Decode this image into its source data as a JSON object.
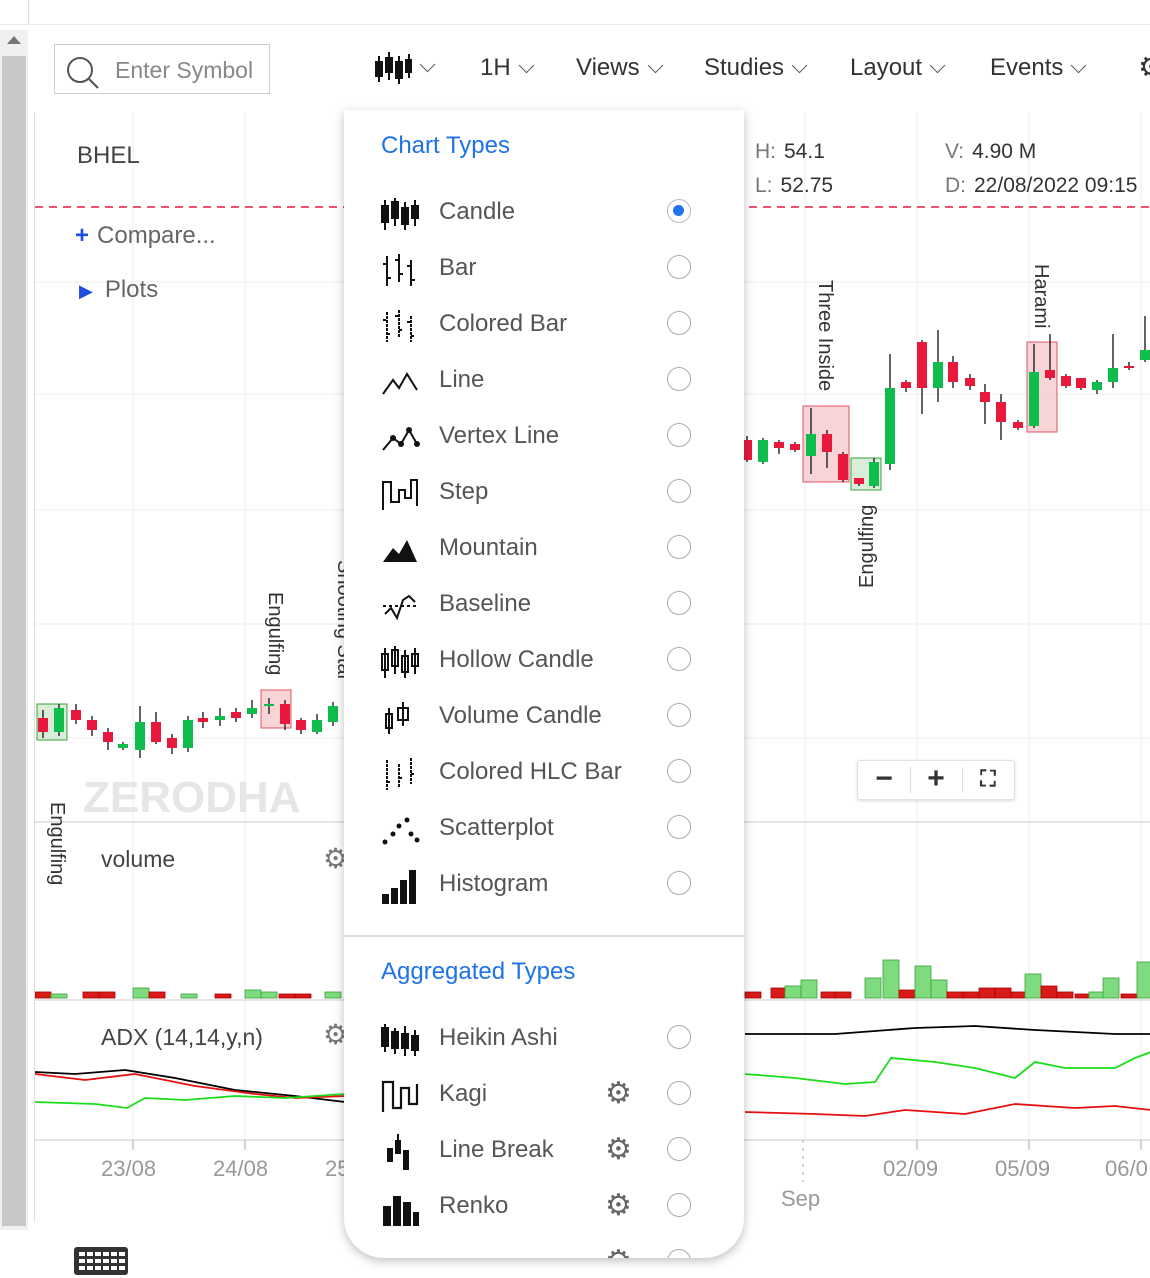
{
  "toolbar": {
    "search_placeholder": "Enter Symbol",
    "interval": "1H",
    "views": "Views",
    "studies": "Studies",
    "layout": "Layout",
    "events": "Events"
  },
  "chart": {
    "symbol": "BHEL",
    "compare": "Compare...",
    "plots": "Plots",
    "ohlc": {
      "h_label": "H:",
      "h": "54.1",
      "l_label": "L:",
      "l": "52.75",
      "v_label": "V:",
      "v": "4.90 M",
      "d_label": "D:",
      "d": "22/08/2022 09:15"
    },
    "panels": {
      "volume": "volume",
      "adx": "ADX (14,14,y,n)"
    },
    "watermark": "ZERODHA",
    "patterns": [
      "Engulfing",
      "Engulfing",
      "Shooting Star",
      "Three Inside",
      "Engulfing",
      "Harami"
    ],
    "time_labels": [
      "23/08",
      "24/08",
      "25",
      "Sep",
      "02/09",
      "05/09",
      "06/0"
    ],
    "colors": {
      "up": "#0ebd4b",
      "down": "#e8193c",
      "adx": "#000000",
      "di_plus": "#1bdd1b",
      "di_minus": "#e61010",
      "accent": "#1e73e8"
    }
  },
  "menu": {
    "chart_types_title": "Chart Types",
    "aggregated_title": "Aggregated Types",
    "chart_types": [
      {
        "name": "Candle",
        "icon": "candle-icon",
        "selected": true
      },
      {
        "name": "Bar",
        "icon": "bar-icon",
        "selected": false
      },
      {
        "name": "Colored Bar",
        "icon": "colored-bar-icon",
        "selected": false
      },
      {
        "name": "Line",
        "icon": "line-icon",
        "selected": false
      },
      {
        "name": "Vertex Line",
        "icon": "vertex-line-icon",
        "selected": false
      },
      {
        "name": "Step",
        "icon": "step-icon",
        "selected": false
      },
      {
        "name": "Mountain",
        "icon": "mountain-icon",
        "selected": false
      },
      {
        "name": "Baseline",
        "icon": "baseline-icon",
        "selected": false
      },
      {
        "name": "Hollow Candle",
        "icon": "hollow-candle-icon",
        "selected": false
      },
      {
        "name": "Volume Candle",
        "icon": "volume-candle-icon",
        "selected": false
      },
      {
        "name": "Colored HLC Bar",
        "icon": "colored-hlc-bar-icon",
        "selected": false
      },
      {
        "name": "Scatterplot",
        "icon": "scatterplot-icon",
        "selected": false
      },
      {
        "name": "Histogram",
        "icon": "histogram-icon",
        "selected": false
      }
    ],
    "aggregated_types": [
      {
        "name": "Heikin Ashi",
        "icon": "heikin-ashi-icon",
        "gear": false
      },
      {
        "name": "Kagi",
        "icon": "kagi-icon",
        "gear": true
      },
      {
        "name": "Line Break",
        "icon": "line-break-icon",
        "gear": true
      },
      {
        "name": "Renko",
        "icon": "renko-icon",
        "gear": true
      }
    ]
  }
}
